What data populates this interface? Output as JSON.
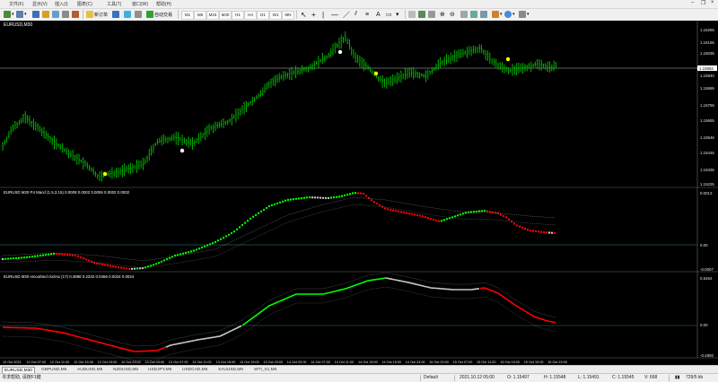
{
  "menu": {
    "items": [
      "文件(F)",
      "显示(V)",
      "插入(I)",
      "图表(C)",
      "工具(T)",
      "窗口(W)",
      "帮助(H)"
    ]
  },
  "toolbar": {
    "new_order_label": "新订单",
    "auto_trading_label": "自动交易",
    "timeframes": [
      "M1",
      "M5",
      "M15",
      "M30",
      "H1",
      "H4",
      "D1",
      "W1",
      "MN"
    ]
  },
  "chart": {
    "title": "EURUSD,M30",
    "price_ticks": [
      "1.16265",
      "1.16155",
      "1.16035",
      "1.15940",
      "1.15865",
      "1.15755",
      "1.15655",
      "1.15545",
      "1.15445",
      "1.15335",
      "1.15225"
    ],
    "current_price": "1.15952",
    "macd_label": "EURUSD M30 P4 Macd (1.5,3.15) 0.0008 0.0002 0.0006 0.0002 0.0002",
    "macd_ticks": [
      "0.0013",
      "0.00",
      "-0.0007"
    ],
    "rsx_label": "EURUSD M30 smoothed rsx/rsx (17) 0.3998 0.2232 0.0466 0.0024 0.0024",
    "rsx_ticks": [
      "0.5464",
      "0.00",
      "-0.4800"
    ],
    "time_labels": [
      "12 Oct 2021",
      "12 Oct 07:00",
      "12 Oct 11:00",
      "12 Oct 15:00",
      "12 Oct 19:00",
      "12 Oct 23:00",
      "13 Oct 03:00",
      "13 Oct 07:00",
      "13 Oct 11:00",
      "13 Oct 15:00",
      "13 Oct 19:00",
      "13 Oct 23:00",
      "14 Oct 03:00",
      "14 Oct 07:00",
      "14 Oct 11:00",
      "14 Oct 15:00",
      "14 Oct 19:00",
      "14 Oct 23:00",
      "15 Oct 03:00",
      "15 Oct 07:00",
      "15 Oct 11:00",
      "15 Oct 15:00",
      "15 Oct 19:00",
      "15 Oct 23:00"
    ]
  },
  "tabs": [
    "EURUSD,M30",
    "GBPUSD,M5",
    "AUDUSD,M5",
    "NZDUSD,M5",
    "USDJPY,M5",
    "USDCAD,M5",
    "XAUUSD,M5",
    "WTI_X1,M5"
  ],
  "status": {
    "help": "寻求帮助, 请按F1键",
    "profile": "Default",
    "time": "2021.10.12 05:00",
    "open": "O: 1.15497",
    "high": "H: 1.15548",
    "low": "L: 1.15491",
    "close": "C: 1.15545",
    "volume": "V: 668",
    "traffic": "729/5 kb"
  },
  "colors": {
    "bull_bar": "#00c000",
    "macd_up": "#00ff00",
    "macd_down": "#ff0000",
    "macd_flat": "#c8c8c8",
    "marker_yellow": "#ffff00",
    "marker_white": "#ffffff"
  }
}
